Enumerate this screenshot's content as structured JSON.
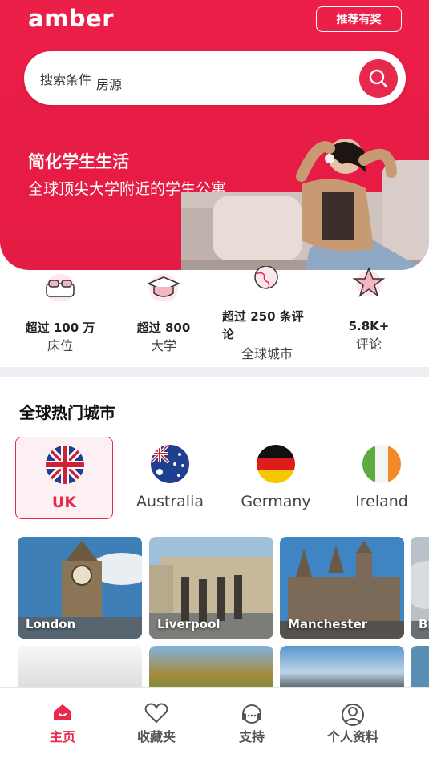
{
  "app": {
    "logo": "amber",
    "accent": "#e8294e"
  },
  "header": {
    "refer_label": "推荐有奖"
  },
  "search": {
    "label": "搜索条件",
    "value": "房源",
    "icon": "search-icon"
  },
  "hero": {
    "title": "简化学生生活",
    "subtitle": "全球顶尖大学附近的学生公寓"
  },
  "stats": [
    {
      "icon": "bed-icon",
      "value": "超过 100 万",
      "label": "床位"
    },
    {
      "icon": "graduation-cap-icon",
      "value": "超过 800",
      "label": "大学"
    },
    {
      "icon": "globe-icon",
      "value": "超过 250 条评论",
      "label": "全球城市"
    },
    {
      "icon": "star-icon",
      "value": "5.8K+",
      "label": "评论"
    }
  ],
  "cities_section": {
    "title": "全球热门城市"
  },
  "countries": [
    {
      "name": "UK",
      "flag": "uk-flag-icon",
      "selected": true
    },
    {
      "name": "Australia",
      "flag": "australia-flag-icon",
      "selected": false
    },
    {
      "name": "Germany",
      "flag": "germany-flag-icon",
      "selected": false
    },
    {
      "name": "Ireland",
      "flag": "ireland-flag-icon",
      "selected": false
    }
  ],
  "cities": [
    {
      "name": "London"
    },
    {
      "name": "Liverpool"
    },
    {
      "name": "Manchester"
    },
    {
      "name": "Bi"
    }
  ],
  "bottom_nav": [
    {
      "label": "主页",
      "icon": "home-icon",
      "active": true
    },
    {
      "label": "收藏夹",
      "icon": "heart-icon",
      "active": false
    },
    {
      "label": "支持",
      "icon": "headset-icon",
      "active": false
    },
    {
      "label": "个人资料",
      "icon": "user-icon",
      "active": false
    }
  ]
}
